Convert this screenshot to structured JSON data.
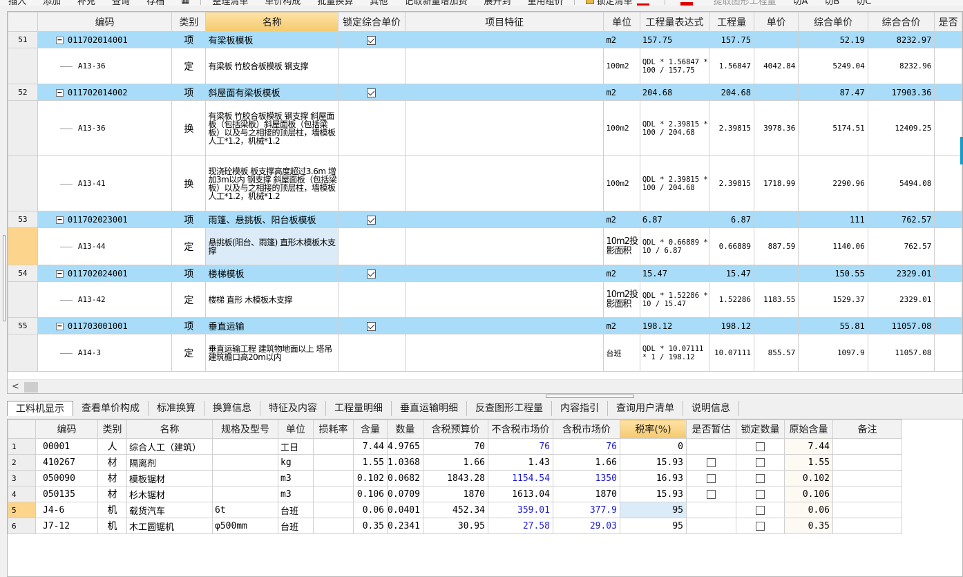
{
  "toolbar": {
    "items": [
      "插入",
      "添加",
      "补充",
      "查询",
      "存档"
    ],
    "items2": [
      "整理清单",
      "单价构成",
      "批量换算",
      "其他",
      "记取新量增加费",
      "展开到",
      "重用组价"
    ],
    "lock_label": "锁定清单",
    "extract_label": "提取图形工程量",
    "switch_a": "切A",
    "switch_b": "切B",
    "switch_c": "切C"
  },
  "top_table": {
    "headers": [
      "编码",
      "类别",
      "名称",
      "锁定综合单价",
      "项目特征",
      "单位",
      "工程量表达式",
      "工程量",
      "单价",
      "综合单价",
      "综合合价",
      "是否"
    ],
    "rows": [
      {
        "type": "item",
        "num": "51",
        "code": "011702014001",
        "cat": "项",
        "name": "有梁板模板",
        "locked": true,
        "feature": "",
        "unit": "m2",
        "expr": "157.75",
        "qty": "157.75",
        "price": "",
        "unit_price": "52.19",
        "total": "8232.97"
      },
      {
        "type": "sub",
        "num": "",
        "code": "A13-36",
        "cat": "定",
        "name": "有梁板 竹胶合板模板 钢支撑",
        "feature": "",
        "unit": "100m2",
        "expr": "QDL * 1.56847 * 100 / 157.75",
        "qty": "1.56847",
        "price": "4042.84",
        "unit_price": "5249.04",
        "total": "8232.96"
      },
      {
        "type": "item",
        "num": "52",
        "code": "011702014002",
        "cat": "项",
        "name": "斜屋面有梁板模板",
        "locked": true,
        "feature": "",
        "unit": "m2",
        "expr": "204.68",
        "qty": "204.68",
        "price": "",
        "unit_price": "87.47",
        "total": "17903.36"
      },
      {
        "type": "sub",
        "num": "",
        "code": "A13-36",
        "cat": "换",
        "name": "有梁板 竹胶合板模板 钢支撑 斜屋面板（包括梁板）斜屋面板（包括梁板）以及与之相接的顶层柱，墙模板 人工*1.2，机械*1.2",
        "feature": "",
        "unit": "100m2",
        "expr": "QDL * 2.39815 * 100 / 204.68",
        "qty": "2.39815",
        "price": "3978.36",
        "unit_price": "5174.51",
        "total": "12409.25"
      },
      {
        "type": "sub",
        "num": "",
        "code": "A13-41",
        "cat": "换",
        "name": "现浇砼模板 板支撑高度超过3.6m 增加3m以内 钢支撑 斜屋面板（包括梁板）以及与之相接的顶层柱，墙模板 人工*1.2，机械*1.2",
        "feature": "",
        "unit": "100m2",
        "expr": "QDL * 2.39815 * 100 / 204.68",
        "qty": "2.39815",
        "price": "1718.99",
        "unit_price": "2290.96",
        "total": "5494.08"
      },
      {
        "type": "item",
        "num": "53",
        "code": "011702023001",
        "cat": "项",
        "name": "雨篷、悬挑板、阳台板模板",
        "locked": true,
        "feature": "",
        "unit": "m2",
        "expr": "6.87",
        "qty": "6.87",
        "price": "",
        "unit_price": "111",
        "total": "762.57"
      },
      {
        "type": "sub",
        "num": "",
        "active": true,
        "selected_name": true,
        "code": "A13-44",
        "cat": "定",
        "name": "悬挑板(阳台、雨篷) 直形木模板木支撑",
        "feature": "",
        "unit": "10m2投影面积",
        "expr": "QDL * 0.66889 * 10 / 6.87",
        "qty": "0.66889",
        "price": "887.59",
        "unit_price": "1140.06",
        "total": "762.57"
      },
      {
        "type": "item",
        "num": "54",
        "code": "011702024001",
        "cat": "项",
        "name": "楼梯模板",
        "locked": true,
        "feature": "",
        "unit": "m2",
        "expr": "15.47",
        "qty": "15.47",
        "price": "",
        "unit_price": "150.55",
        "total": "2329.01"
      },
      {
        "type": "sub",
        "num": "",
        "code": "A13-42",
        "cat": "定",
        "name": "楼梯 直形 木模板木支撑",
        "feature": "",
        "unit": "10m2投影面积",
        "expr": "QDL * 1.52286 * 10 / 15.47",
        "qty": "1.52286",
        "price": "1183.55",
        "unit_price": "1529.37",
        "total": "2329.01"
      },
      {
        "type": "item",
        "num": "55",
        "code": "011703001001",
        "cat": "项",
        "name": "垂直运输",
        "locked": true,
        "feature": "",
        "unit": "m2",
        "expr": "198.12",
        "qty": "198.12",
        "price": "",
        "unit_price": "55.81",
        "total": "11057.08"
      },
      {
        "type": "sub",
        "num": "",
        "code": "A14-3",
        "cat": "定",
        "name": "垂直运输工程 建筑物地面以上 塔吊 建筑檐口高20m以内",
        "feature": "",
        "unit": "台班",
        "expr": "QDL * 10.07111 * 1 / 198.12",
        "qty": "10.07111",
        "price": "855.57",
        "unit_price": "1097.9",
        "total": "11057.08"
      }
    ]
  },
  "tabs": [
    "工料机显示",
    "查看单价构成",
    "标准换算",
    "换算信息",
    "特征及内容",
    "工程量明细",
    "垂直运输明细",
    "反查图形工程量",
    "内容指引",
    "查询用户清单",
    "说明信息"
  ],
  "active_tab": "工料机显示",
  "bottom_table": {
    "headers": [
      "编码",
      "类别",
      "名称",
      "规格及型号",
      "单位",
      "损耗率",
      "含量",
      "数量",
      "含税预算价",
      "不含税市场价",
      "含税市场价",
      "税率(%)",
      "是否暂估",
      "锁定数量",
      "原始含量",
      "备注"
    ],
    "rows": [
      {
        "num": "1",
        "code": "00001",
        "cat": "人",
        "name": "综合人工（建筑）",
        "spec": "",
        "unit": "工日",
        "loss": "",
        "content": "7.44",
        "qty": "4.9765",
        "budget": "70",
        "market_ex": "76",
        "market_in": "76",
        "tax": "0",
        "provisional": null,
        "lock_qty": false,
        "orig": "7.44",
        "note": "",
        "blue": true
      },
      {
        "num": "2",
        "code": "410267",
        "cat": "材",
        "name": "隔离剂",
        "spec": "",
        "unit": "kg",
        "loss": "",
        "content": "1.55",
        "qty": "1.0368",
        "budget": "1.66",
        "market_ex": "1.43",
        "market_in": "1.66",
        "tax": "15.93",
        "provisional": false,
        "lock_qty": false,
        "orig": "1.55",
        "note": "",
        "blue": false
      },
      {
        "num": "3",
        "code": "050090",
        "cat": "材",
        "name": "模板锯材",
        "spec": "",
        "unit": "m3",
        "loss": "",
        "content": "0.102",
        "qty": "0.0682",
        "budget": "1843.28",
        "market_ex": "1154.54",
        "market_in": "1350",
        "tax": "16.93",
        "provisional": false,
        "lock_qty": false,
        "orig": "0.102",
        "note": "",
        "blue": true
      },
      {
        "num": "4",
        "code": "050135",
        "cat": "材",
        "name": "杉木锯材",
        "spec": "",
        "unit": "m3",
        "loss": "",
        "content": "0.106",
        "qty": "0.0709",
        "budget": "1870",
        "market_ex": "1613.04",
        "market_in": "1870",
        "tax": "15.93",
        "provisional": false,
        "lock_qty": false,
        "orig": "0.106",
        "note": "",
        "blue": false
      },
      {
        "num": "5",
        "code": "J4-6",
        "cat": "机",
        "name": "载货汽车",
        "spec": "6t",
        "unit": "台班",
        "loss": "",
        "content": "0.06",
        "qty": "0.0401",
        "budget": "452.34",
        "market_ex": "359.01",
        "market_in": "377.9",
        "tax": "95",
        "provisional": null,
        "lock_qty": false,
        "orig": "0.06",
        "note": "",
        "blue": true,
        "active": true
      },
      {
        "num": "6",
        "code": "J7-12",
        "cat": "机",
        "name": "木工圆锯机",
        "spec": "φ500mm",
        "unit": "台班",
        "loss": "",
        "content": "0.35",
        "qty": "0.2341",
        "budget": "30.95",
        "market_ex": "27.58",
        "market_in": "29.03",
        "tax": "95",
        "provisional": null,
        "lock_qty": false,
        "orig": "0.35",
        "note": "",
        "blue": true
      }
    ]
  },
  "colors": {
    "item_row": "#a8dcf8",
    "sorted_header": "#f5c96e",
    "active_row_marker": "#fcd48c",
    "highlight_value": "#1a1ad8",
    "red_marker": "#e00000"
  }
}
